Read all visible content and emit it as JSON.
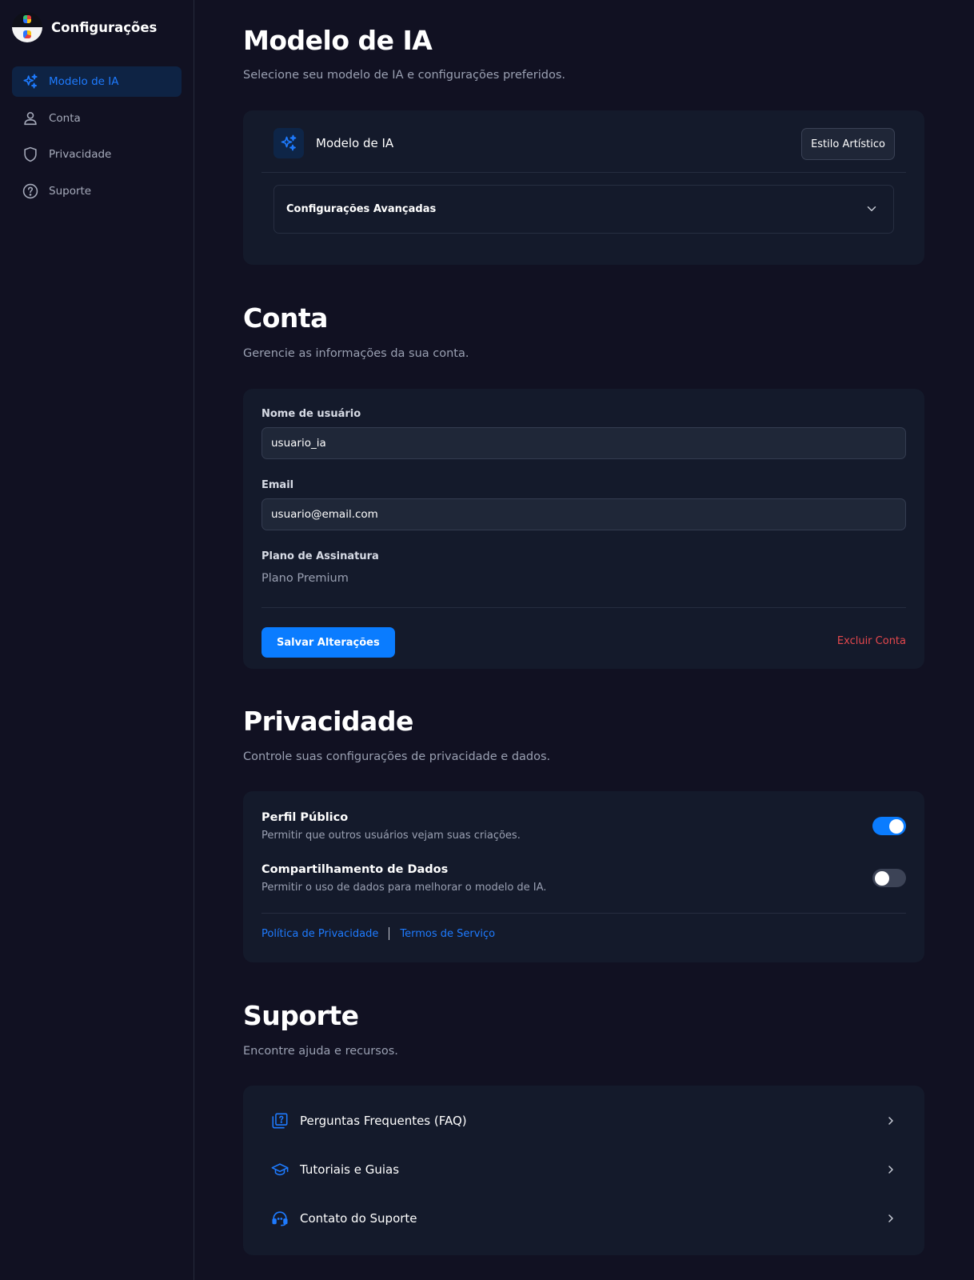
{
  "sidebar": {
    "title": "Configurações",
    "items": [
      {
        "label": "Modelo de IA",
        "icon": "sparkles-icon",
        "active": true
      },
      {
        "label": "Conta",
        "icon": "user-icon",
        "active": false
      },
      {
        "label": "Privacidade",
        "icon": "shield-icon",
        "active": false
      },
      {
        "label": "Suporte",
        "icon": "help-circle-icon",
        "active": false
      }
    ]
  },
  "model_section": {
    "title": "Modelo de IA",
    "subtitle": "Selecione seu modelo de IA e configurações preferidos.",
    "card_title": "Modelo de IA",
    "style_button": "Estilo Artístico",
    "advanced_label": "Configurações Avançadas"
  },
  "account_section": {
    "title": "Conta",
    "subtitle": "Gerencie as informações da sua conta.",
    "username_label": "Nome de usuário",
    "username_value": "usuario_ia",
    "email_label": "Email",
    "email_value": "usuario@email.com",
    "plan_label": "Plano de Assinatura",
    "plan_value": "Plano Premium",
    "save_button": "Salvar Alterações",
    "delete_link": "Excluir Conta"
  },
  "privacy_section": {
    "title": "Privacidade",
    "subtitle": "Controle suas configurações de privacidade e dados.",
    "options": [
      {
        "title": "Perfil Público",
        "description": "Permitir que outros usuários vejam suas criações.",
        "enabled": true
      },
      {
        "title": "Compartilhamento de Dados",
        "description": "Permitir o uso de dados para melhorar o modelo de IA.",
        "enabled": false
      }
    ],
    "privacy_policy_link": "Política de Privacidade",
    "terms_link": "Termos de Serviço"
  },
  "support_section": {
    "title": "Suporte",
    "subtitle": "Encontre ajuda e recursos.",
    "items": [
      {
        "label": "Perguntas Frequentes (FAQ)",
        "icon": "faq-icon"
      },
      {
        "label": "Tutoriais e Guias",
        "icon": "graduation-cap-icon"
      },
      {
        "label": "Contato do Suporte",
        "icon": "headset-icon"
      }
    ]
  },
  "colors": {
    "background": "#111122",
    "card": "#141a2b",
    "accent": "#0a7cff",
    "danger": "#e5484d"
  }
}
